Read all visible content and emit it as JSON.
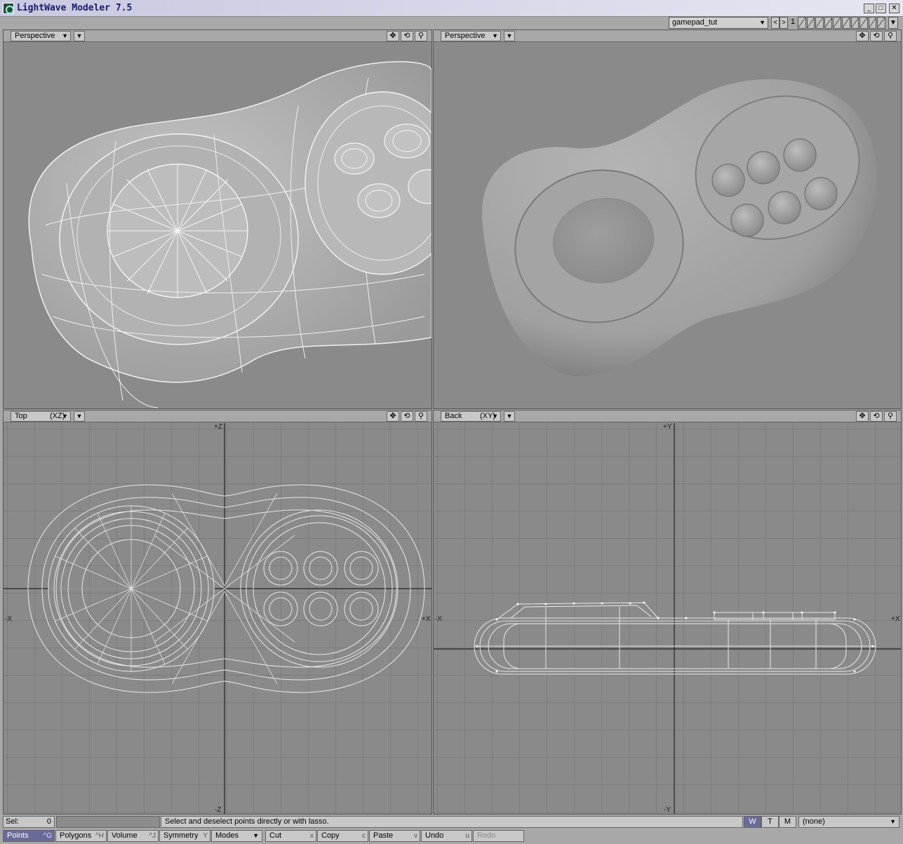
{
  "window": {
    "title": "LightWave Modeler 7.5",
    "controls": [
      "_",
      "□",
      "✕"
    ]
  },
  "topbar": {
    "object": "gamepad_tut",
    "prev": "<",
    "next": ">",
    "layer_number": "1"
  },
  "viewports": [
    {
      "view": "Perspective",
      "axis": "",
      "mode": "wireframe-shaded"
    },
    {
      "view": "Perspective",
      "axis": "",
      "mode": "smooth-shaded"
    },
    {
      "view": "Top",
      "axis": "(XZ)",
      "mode": "wireframe",
      "labels": {
        "up": "+Z",
        "down": "-Z",
        "left": "-X",
        "right": "+X"
      }
    },
    {
      "view": "Back",
      "axis": "(XY)",
      "mode": "wireframe",
      "labels": {
        "up": "+Y",
        "down": "-Y",
        "left": "-X",
        "right": "+X"
      }
    }
  ],
  "viewport_tools": {
    "move_icon": "✥",
    "rotate_icon": "⟲",
    "zoom_icon": "⚲"
  },
  "status": {
    "sel_label": "Sel:",
    "sel_value": "0",
    "help_text": "Select and deselect points directly or with lasso.",
    "wtm": [
      "W",
      "T",
      "M"
    ],
    "surface": "(none)"
  },
  "toolbar": {
    "points": {
      "label": "Points",
      "key": "^G"
    },
    "polygons": {
      "label": "Polygons",
      "key": "^H"
    },
    "volume": {
      "label": "Volume",
      "key": "^J"
    },
    "symmetry": {
      "label": "Symmetry",
      "key": "Y"
    },
    "modes": {
      "label": "Modes"
    },
    "cut": {
      "label": "Cut",
      "key": "x"
    },
    "copy": {
      "label": "Copy",
      "key": "c"
    },
    "paste": {
      "label": "Paste",
      "key": "v"
    },
    "undo": {
      "label": "Undo",
      "key": "u"
    },
    "redo": {
      "label": "Redo"
    }
  },
  "colors": {
    "viewport_bg": "#8a8a8a",
    "wire": "#f0f0f0",
    "grid": "#6e6e6e",
    "active_button": "#6a6a9a"
  }
}
